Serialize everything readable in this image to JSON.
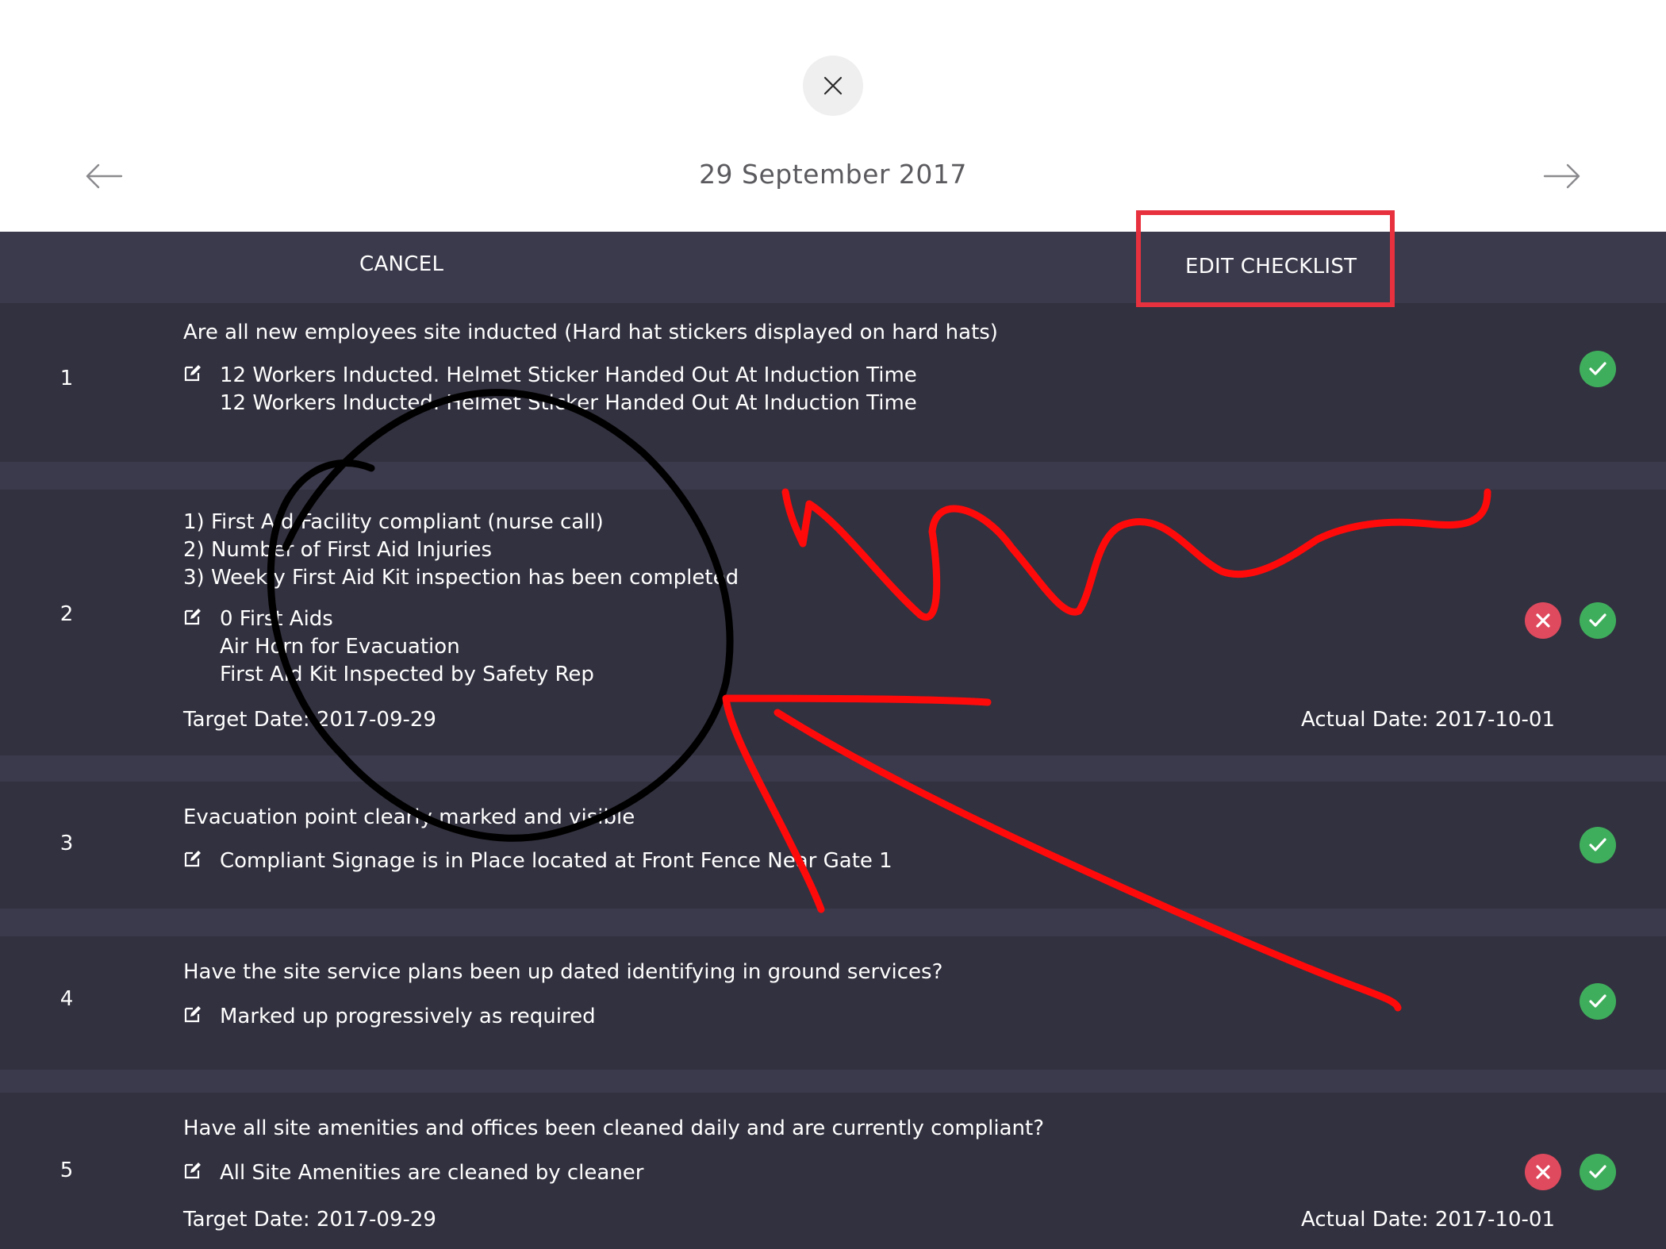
{
  "header": {
    "date": "29 September 2017",
    "close_icon": "close-icon",
    "prev_icon": "arrow-left-icon",
    "next_icon": "arrow-right-icon"
  },
  "toolbar": {
    "cancel_label": "CANCEL",
    "edit_label": "EDIT CHECKLIST"
  },
  "colors": {
    "content_bg": "#3b3a4c",
    "row_bg": "#32313f",
    "ok": "#3fae5c",
    "fail": "#e04a5e",
    "highlight": "#e8313f",
    "annotation_red": "#ff0a0a",
    "annotation_black": "#000000"
  },
  "items": [
    {
      "number": "1",
      "question": [
        "Are all new employees site inducted (Hard hat stickers displayed on hard hats)"
      ],
      "note": [
        "12 Workers Inducted. Helmet Sticker Handed Out At Induction Time",
        "12 Workers Inducted. Helmet Sticker Handed Out At Induction Time"
      ],
      "status": [
        "ok"
      ]
    },
    {
      "number": "2",
      "question": [
        "1) First Aid Facility compliant (nurse call)",
        "2) Number of First Aid Injuries",
        "3) Weekly First Aid Kit inspection has been completed"
      ],
      "note": [
        "0 First Aids",
        "Air Horn for Evacuation",
        "First Aid Kit Inspected by Safety Rep"
      ],
      "target_date": "Target Date: 2017-09-29",
      "actual_date": "Actual Date: 2017-10-01",
      "status": [
        "fail",
        "ok"
      ]
    },
    {
      "number": "3",
      "question": [
        "Evacuation point clearly marked and visible"
      ],
      "note": [
        "Compliant Signage is in Place located at Front Fence Near Gate 1"
      ],
      "status": [
        "ok"
      ]
    },
    {
      "number": "4",
      "question": [
        "Have the site service plans been up dated identifying in ground services?"
      ],
      "note": [
        "Marked up progressively as required"
      ],
      "status": [
        "ok"
      ]
    },
    {
      "number": "5",
      "question": [
        "Have all site amenities and offices been cleaned daily and are currently compliant?"
      ],
      "note": [
        "All Site Amenities are cleaned by cleaner"
      ],
      "target_date": "Target Date: 2017-09-29",
      "actual_date": "Actual Date: 2017-10-01",
      "status": [
        "fail",
        "ok"
      ]
    }
  ]
}
